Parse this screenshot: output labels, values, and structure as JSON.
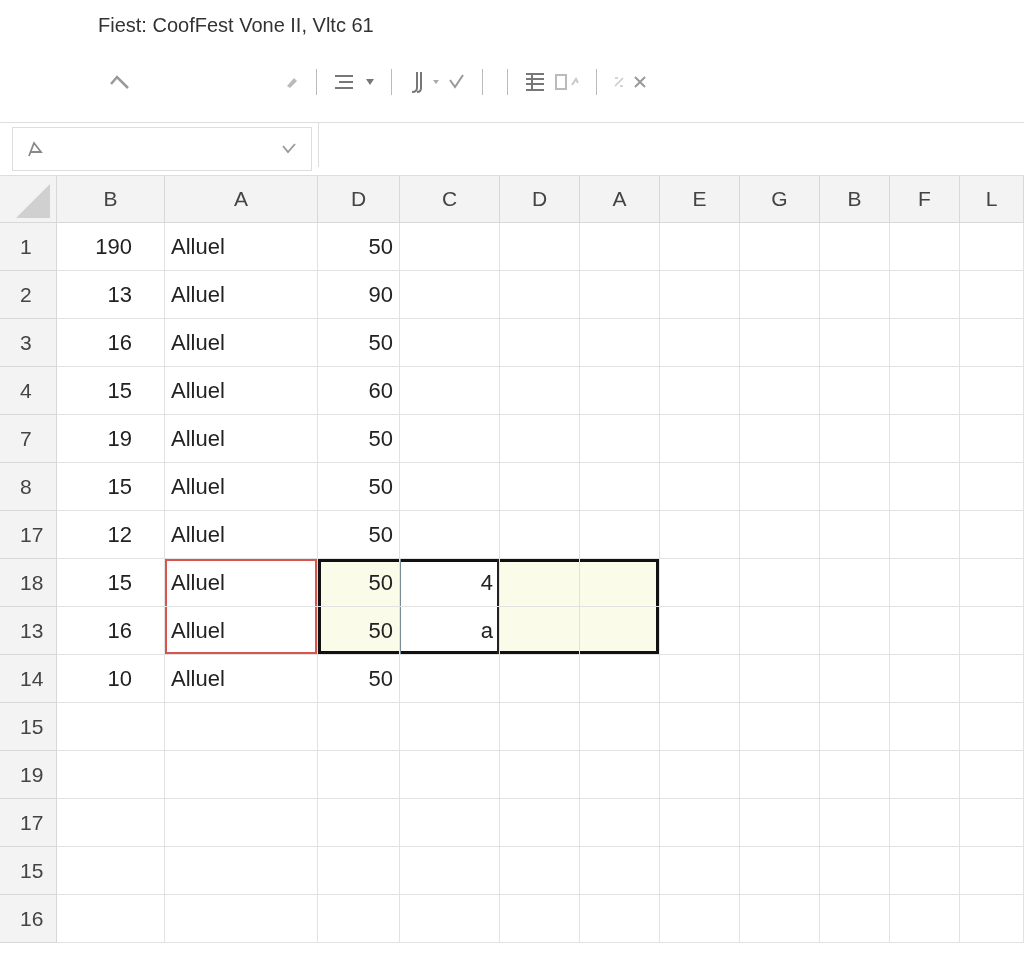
{
  "window": {
    "title": "Fiest: CoofFest Vone II, Vltc 61"
  },
  "table": {
    "columns": [
      "B",
      "A",
      "D",
      "C",
      "D",
      "A",
      "E",
      "G",
      "B",
      "F",
      "L"
    ],
    "rows": [
      {
        "header": "1",
        "cells": [
          "190",
          "Alluel",
          "50"
        ],
        "selected": false
      },
      {
        "header": "2",
        "cells": [
          "13",
          "Alluel",
          "90"
        ],
        "selected": false
      },
      {
        "header": "3",
        "cells": [
          "16",
          "Alluel",
          "50"
        ],
        "selected": false
      },
      {
        "header": "4",
        "cells": [
          "15",
          "Alluel",
          "60"
        ],
        "selected": false
      },
      {
        "header": "7",
        "cells": [
          "19",
          "Alluel",
          "50"
        ],
        "selected": false
      },
      {
        "header": "8",
        "cells": [
          "15",
          "Alluel",
          "50"
        ],
        "selected": false
      },
      {
        "header": "17",
        "cells": [
          "12",
          "Alluel",
          "50"
        ],
        "selected": false
      },
      {
        "header": "18",
        "cells": [
          "15",
          "Alluel",
          "50",
          "4"
        ],
        "selected": true
      },
      {
        "header": "13",
        "cells": [
          "16",
          "Alluel",
          "50",
          "a"
        ],
        "selected": true
      },
      {
        "header": "14",
        "cells": [
          "10",
          "Alluel",
          "50"
        ],
        "selected": false
      },
      {
        "header": "15",
        "cells": [],
        "selected": false
      },
      {
        "header": "19",
        "cells": [],
        "selected": false
      },
      {
        "header": "17",
        "cells": [],
        "selected": false
      },
      {
        "header": "15",
        "cells": [],
        "selected": false
      },
      {
        "header": "16",
        "cells": [],
        "selected": false
      }
    ]
  }
}
